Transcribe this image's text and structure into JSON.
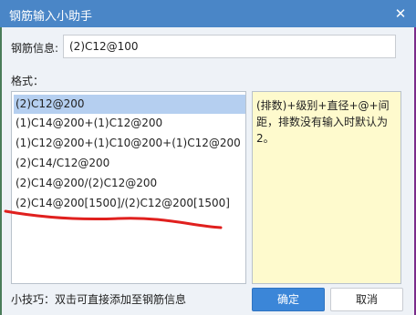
{
  "window": {
    "title": "钢筋输入小助手",
    "close_glyph": "✕"
  },
  "info": {
    "label": "钢筋信息:",
    "value": "(2)C12@100"
  },
  "format": {
    "label": "格式：",
    "items": [
      "(2)C12@200",
      "(1)C14@200+(1)C12@200",
      "(1)C12@200+(1)C10@200+(1)C12@200",
      "(2)C14/C12@200",
      "(2)C14@200/(2)C12@200",
      "(2)C14@200[1500]/(2)C12@200[1500]"
    ],
    "selected_index": 0
  },
  "hint": {
    "text": "(排数)+级别+直径+@+间距，排数没有输入时默认为2。"
  },
  "footer": {
    "tip": "小技巧：双击可直接添加至钢筋信息",
    "ok_label": "确定",
    "cancel_label": "取消"
  },
  "colors": {
    "titlebar": "#4a86c7",
    "selection": "#b5cff0",
    "hint_bg": "#fefacd",
    "ok_button": "#3b86d8",
    "annotation": "#e0201e"
  }
}
